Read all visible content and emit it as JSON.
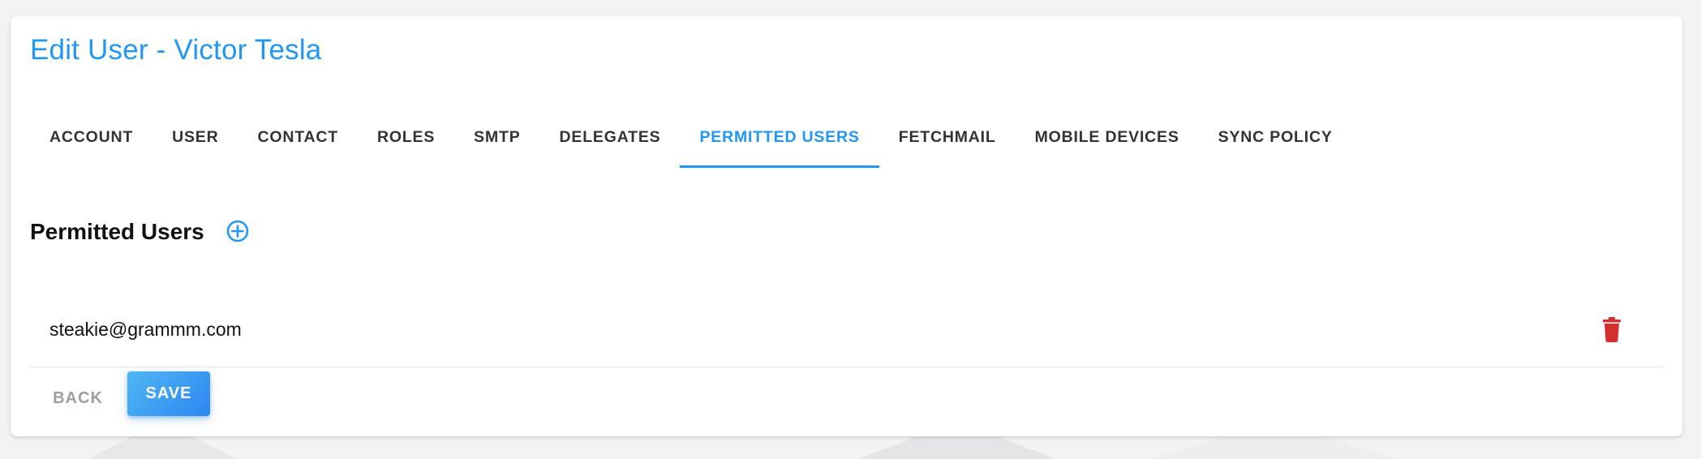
{
  "header": {
    "title": "Edit User - Victor Tesla"
  },
  "tabs": [
    {
      "label": "ACCOUNT",
      "active": false
    },
    {
      "label": "USER",
      "active": false
    },
    {
      "label": "CONTACT",
      "active": false
    },
    {
      "label": "ROLES",
      "active": false
    },
    {
      "label": "SMTP",
      "active": false
    },
    {
      "label": "DELEGATES",
      "active": false
    },
    {
      "label": "PERMITTED USERS",
      "active": true
    },
    {
      "label": "FETCHMAIL",
      "active": false
    },
    {
      "label": "MOBILE DEVICES",
      "active": false
    },
    {
      "label": "SYNC POLICY",
      "active": false
    }
  ],
  "section": {
    "title": "Permitted Users",
    "add_icon": "add-circle-icon"
  },
  "permitted_users": [
    {
      "email": "steakie@grammm.com",
      "action_icon": "trash-icon"
    }
  ],
  "actions": {
    "back_label": "BACK",
    "save_label": "SAVE"
  },
  "colors": {
    "accent": "#2196f3",
    "delete": "#d32f2f",
    "text": "#333333",
    "muted": "#9e9e9e"
  }
}
